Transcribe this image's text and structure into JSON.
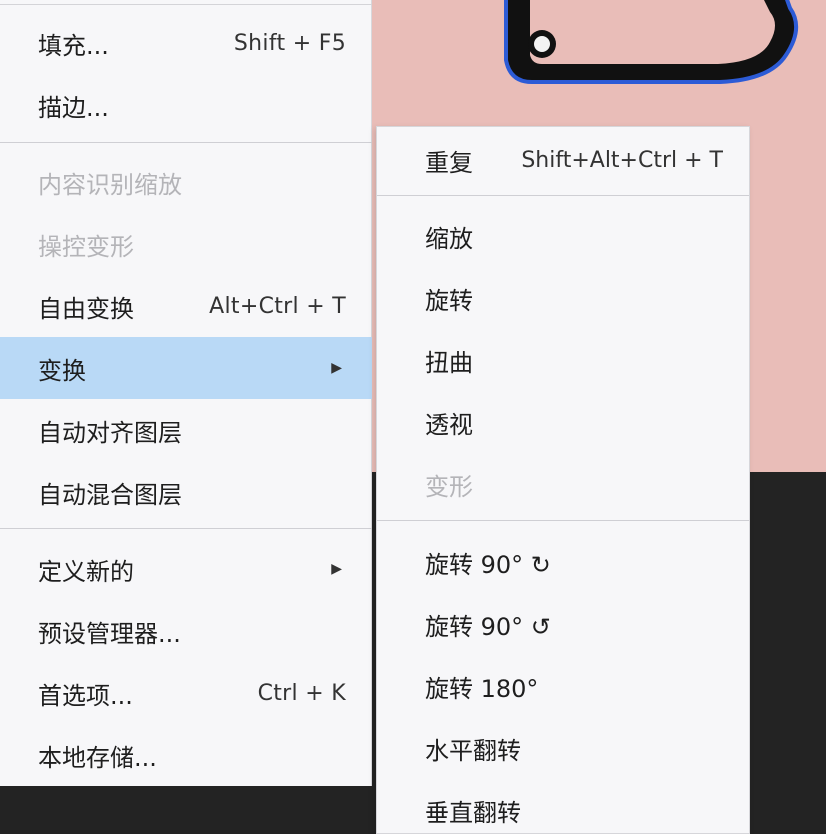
{
  "edit_menu": {
    "items": [
      {
        "label": "填充...",
        "shortcut": "Shift + F5"
      },
      {
        "label": "描边..."
      },
      {
        "label": "内容识别缩放"
      },
      {
        "label": "操控变形"
      },
      {
        "label": "自由变换",
        "shortcut": "Alt+Ctrl + T"
      },
      {
        "label": "变换",
        "arrow": "▶"
      },
      {
        "label": "自动对齐图层"
      },
      {
        "label": "自动混合图层"
      },
      {
        "label": "定义新的",
        "arrow": "▶"
      },
      {
        "label": "预设管理器..."
      },
      {
        "label": "首选项...",
        "shortcut": "Ctrl + K"
      },
      {
        "label": "本地存储..."
      }
    ]
  },
  "transform_submenu": {
    "items": [
      {
        "label": "重复",
        "shortcut": "Shift+Alt+Ctrl + T"
      },
      {
        "label": "缩放"
      },
      {
        "label": "旋转"
      },
      {
        "label": "扭曲"
      },
      {
        "label": "透视"
      },
      {
        "label": "变形"
      },
      {
        "label": "旋转 90° ↻"
      },
      {
        "label": "旋转 90° ↺"
      },
      {
        "label": "旋转 180°"
      },
      {
        "label": "水平翻转"
      },
      {
        "label": "垂直翻转"
      }
    ]
  },
  "colors": {
    "menu_bg": "#f7f7f9",
    "highlight": "#b9d9f6",
    "disabled_text": "#b4b4b8",
    "canvas_pink": "#e9bdb8",
    "canvas_dark": "#232323"
  }
}
